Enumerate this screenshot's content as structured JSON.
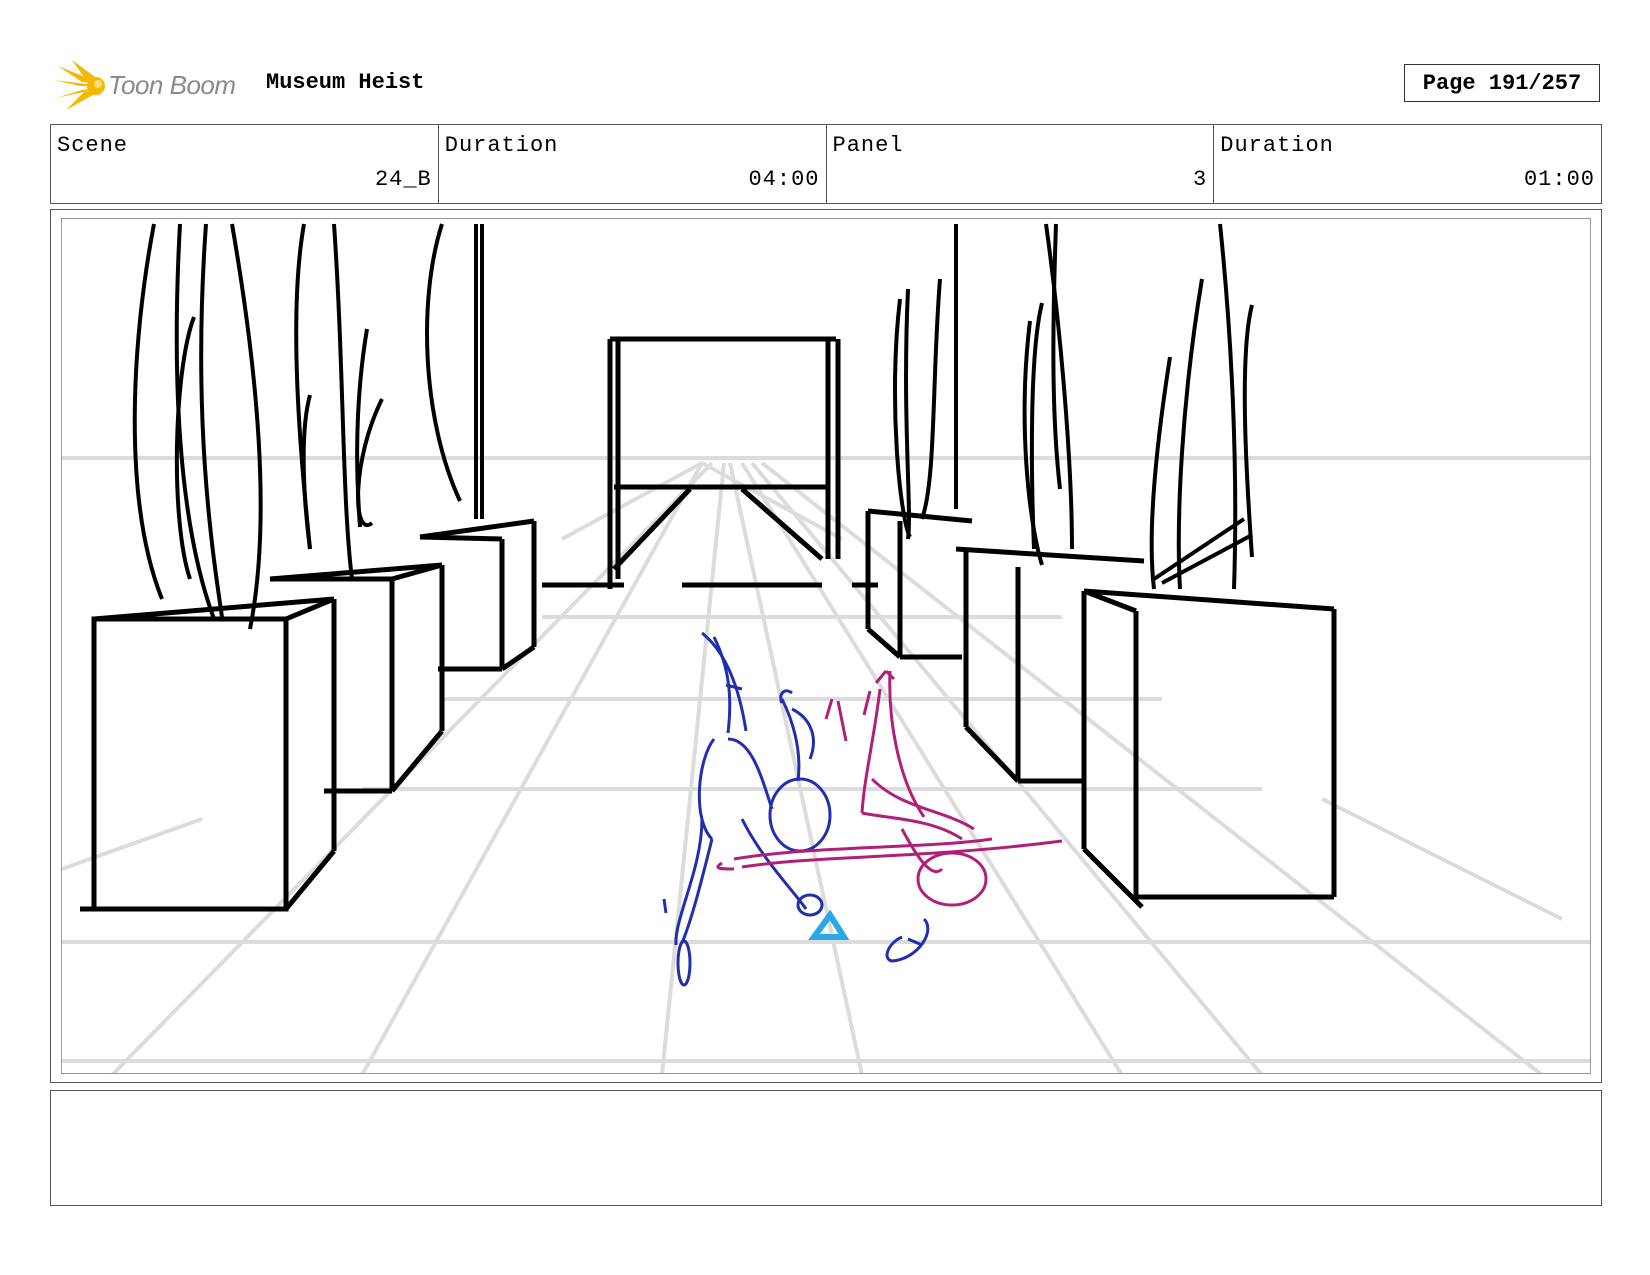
{
  "header": {
    "logo_text": "Toon Boom",
    "project_title": "Museum Heist",
    "page_label": "Page 191/257"
  },
  "info": {
    "scene_label": "Scene",
    "scene_value": "24_B",
    "scene_duration_label": "Duration",
    "scene_duration_value": "04:00",
    "panel_label": "Panel",
    "panel_value": "3",
    "panel_duration_label": "Duration",
    "panel_duration_value": "01:00"
  },
  "notes": {
    "text": ""
  },
  "colors": {
    "logo_accent": "#f5b800",
    "figure_blue": "#1f2fb0",
    "figure_magenta": "#b0207a",
    "object_cyan": "#2aa7e8",
    "guide_gray": "#dcdcdc"
  }
}
